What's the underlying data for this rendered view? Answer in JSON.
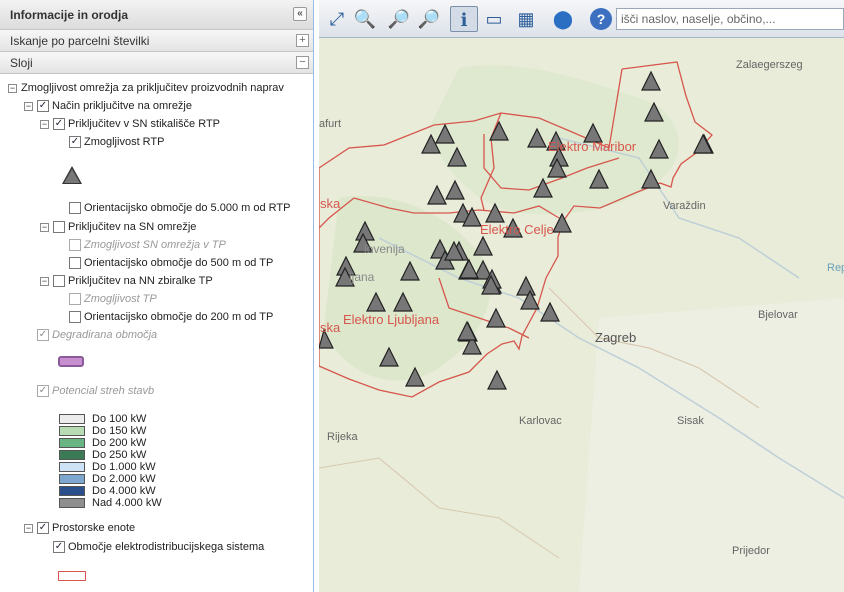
{
  "panel": {
    "title": "Informacije in orodja",
    "collapse": "«"
  },
  "accordion": [
    {
      "label": "Iskanje po parcelni številki",
      "btn": "+"
    },
    {
      "label": "Sloji",
      "btn": "−"
    }
  ],
  "tree": {
    "root": "Zmogljivost omrežja za priključitev proizvodnih naprav",
    "mode": "Način priključitve na omrežje",
    "rtp": "Priključitev v SN stikališče RTP",
    "rtp_cap": "Zmogljivost RTP",
    "rtp_orient": "Orientacijsko območje do 5.000 m od RTP",
    "sn": "Priključitev na SN omrežje",
    "sn_cap": "Zmogljivost SN omrežja v TP",
    "sn_orient": "Orientacijsko območje do 500 m od TP",
    "nn": "Priključitev na NN zbiralke TP",
    "nn_cap": "Zmogljivost TP",
    "nn_orient": "Orientacijsko območje do 200 m od TP",
    "degraded": "Degradirana območja",
    "roofs": "Potencial streh stavb",
    "spatial": "Prostorske enote",
    "area": "Območje elektrodistribucijskega sistema"
  },
  "roof_legend": [
    {
      "label": "Do 100 kW",
      "color": "#ececec"
    },
    {
      "label": "Do 150 kW",
      "color": "#b7dbb2"
    },
    {
      "label": "Do 200 kW",
      "color": "#69b483"
    },
    {
      "label": "Do 250 kW",
      "color": "#3a7a55"
    },
    {
      "label": "Do 1.000 kW",
      "color": "#cfe2f5"
    },
    {
      "label": "Do 2.000 kW",
      "color": "#7ea7cf"
    },
    {
      "label": "Do 4.000 kW",
      "color": "#2b4f8a"
    },
    {
      "label": "Nad 4.000 kW",
      "color": "#8e8e8e"
    }
  ],
  "colors": {
    "degraded": "#c78fcf",
    "boundary": "#d7564d"
  },
  "search": {
    "placeholder": "išči naslov, naselje, občino,..."
  },
  "toolbar_icons": [
    "zoom-extent-icon",
    "zoom-previous-icon",
    "zoom-in-icon",
    "zoom-out-icon",
    "identify-icon",
    "measure-icon",
    "print-icon",
    "location-pin-icon",
    "help-icon"
  ],
  "map_labels": {
    "zalaegerszeg": "Zalaegerszeg",
    "maribor": "Elektro Maribor",
    "celje": "Elektro Celje",
    "ljubljana": "Elektro Ljubljana",
    "varazdin": "Varaždin",
    "zagreb": "Zagreb",
    "bjelovar": "Bjelovar",
    "karlovac": "Karlovac",
    "sisak": "Sisak",
    "rijeka": "Rijeka",
    "prijedor": "Prijedor",
    "lovenija": "lovenija",
    "ljubljana_city": "ljana",
    "ska1": "ska",
    "ska2": "ska",
    "afurt": "afurt",
    "rep": "Rep"
  }
}
